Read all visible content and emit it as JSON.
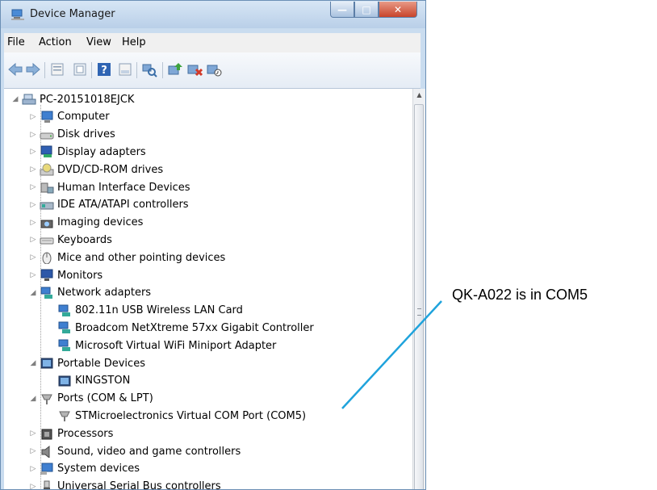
{
  "window": {
    "title": "Device Manager"
  },
  "menu": [
    "File",
    "Action",
    "View",
    "Help"
  ],
  "toolbar_icons": [
    "back-icon",
    "forward-icon",
    "properties-icon",
    "help-icon",
    "details-icon",
    "scan-hardware-icon",
    "update-driver-icon",
    "uninstall-icon",
    "disable-icon"
  ],
  "tree": {
    "root": "PC-20151018EJCK",
    "items": [
      {
        "label": "Computer",
        "icon": "computer-icon",
        "expanded": false
      },
      {
        "label": "Disk drives",
        "icon": "disk-drive-icon",
        "expanded": false
      },
      {
        "label": "Display adapters",
        "icon": "display-adapter-icon",
        "expanded": false
      },
      {
        "label": "DVD/CD-ROM drives",
        "icon": "dvd-drive-icon",
        "expanded": false
      },
      {
        "label": "Human Interface Devices",
        "icon": "hid-icon",
        "expanded": false
      },
      {
        "label": "IDE ATA/ATAPI controllers",
        "icon": "ide-controller-icon",
        "expanded": false
      },
      {
        "label": "Imaging devices",
        "icon": "camera-icon",
        "expanded": false
      },
      {
        "label": "Keyboards",
        "icon": "keyboard-icon",
        "expanded": false
      },
      {
        "label": "Mice and other pointing devices",
        "icon": "mouse-icon",
        "expanded": false
      },
      {
        "label": "Monitors",
        "icon": "monitor-icon",
        "expanded": false
      },
      {
        "label": "Network adapters",
        "icon": "network-adapter-icon",
        "expanded": true,
        "children": [
          "802.11n USB Wireless LAN Card",
          "Broadcom NetXtreme 57xx Gigabit Controller",
          "Microsoft Virtual WiFi Miniport Adapter"
        ]
      },
      {
        "label": "Portable Devices",
        "icon": "portable-device-icon",
        "expanded": true,
        "children": [
          "KINGSTON"
        ]
      },
      {
        "label": "Ports (COM & LPT)",
        "icon": "port-icon",
        "expanded": true,
        "children": [
          "STMicroelectronics Virtual COM Port (COM5)"
        ]
      },
      {
        "label": "Processors",
        "icon": "processor-icon",
        "expanded": false
      },
      {
        "label": "Sound, video and game controllers",
        "icon": "sound-icon",
        "expanded": false
      },
      {
        "label": "System devices",
        "icon": "system-device-icon",
        "expanded": false
      },
      {
        "label": "Universal Serial Bus controllers",
        "icon": "usb-icon",
        "expanded": false
      }
    ]
  },
  "annotation": {
    "text": "QK-A022 is in COM5",
    "line_color": "#1fa3dc"
  }
}
